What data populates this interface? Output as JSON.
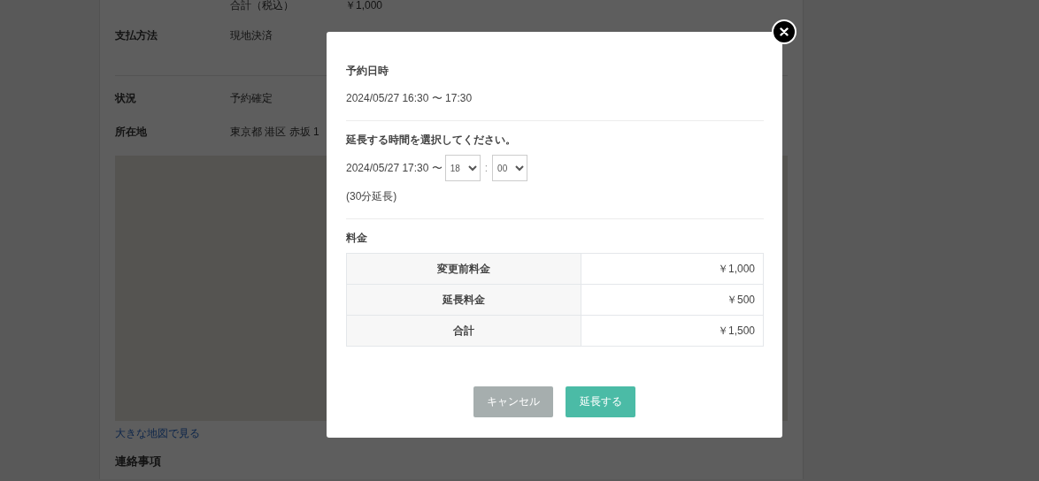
{
  "background_page": {
    "summary_rows": [
      {
        "label": "合計（税込）",
        "value": "￥1,000"
      }
    ],
    "details": [
      {
        "label": "支払方法",
        "value": "現地決済",
        "divider": true
      },
      {
        "label": "状況",
        "value": "予約確定",
        "divider": false
      },
      {
        "label": "所在地",
        "value": "東京都 港区 赤坂 1",
        "divider": false
      }
    ],
    "map_link": "大きな地図で見る",
    "section_title": "連絡事項"
  },
  "modal": {
    "reservation": {
      "title": "予約日時",
      "value": "2024/05/27 16:30 〜 17:30"
    },
    "extension": {
      "title": "延長する時間を選択してください。",
      "start": "2024/05/27 17:30 〜",
      "hour": "18",
      "separator": ":",
      "minute": "00",
      "note": "(30分延長)"
    },
    "fees": {
      "title": "料金",
      "rows": [
        {
          "label": "変更前料金",
          "value": "￥1,000"
        },
        {
          "label": "延長料金",
          "value": "￥500"
        },
        {
          "label": "合計",
          "value": "￥1,500"
        }
      ]
    },
    "buttons": [
      {
        "kind": "cancel",
        "label": "キャンセル"
      },
      {
        "kind": "primary",
        "label": "延長する"
      }
    ]
  }
}
